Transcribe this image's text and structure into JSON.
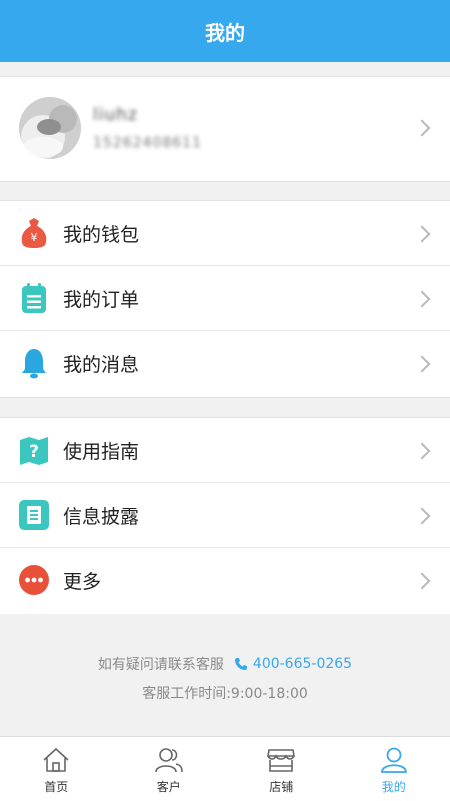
{
  "header": {
    "title": "我的"
  },
  "profile": {
    "name": "liuhz",
    "phone": "15262408611"
  },
  "menu_group1": [
    {
      "label": "我的钱包",
      "icon": "money-bag-icon"
    },
    {
      "label": "我的订单",
      "icon": "clipboard-icon"
    },
    {
      "label": "我的消息",
      "icon": "bell-icon"
    }
  ],
  "menu_group2": [
    {
      "label": "使用指南",
      "icon": "question-map-icon"
    },
    {
      "label": "信息披露",
      "icon": "document-icon"
    },
    {
      "label": "更多",
      "icon": "more-icon"
    }
  ],
  "footer": {
    "help_text": "如有疑问请联系客服",
    "phone": "400-665-0265",
    "hours": "客服工作时间:9:00-18:00"
  },
  "tabbar": [
    {
      "label": "首页",
      "icon": "home-icon"
    },
    {
      "label": "客户",
      "icon": "customers-icon"
    },
    {
      "label": "店铺",
      "icon": "store-icon"
    },
    {
      "label": "我的",
      "icon": "profile-icon",
      "active": true
    }
  ],
  "colors": {
    "accent": "#35a8ee",
    "wallet": "#ea5a43",
    "teal": "#3cc6c0",
    "bell": "#2aa7df",
    "more": "#e8503a"
  }
}
